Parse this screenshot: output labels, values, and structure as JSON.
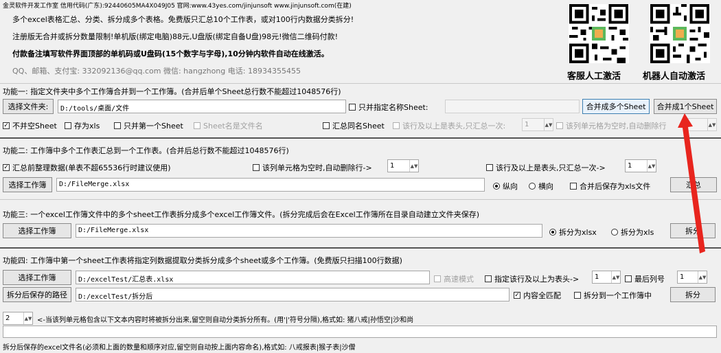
{
  "header": {
    "company_line": "金灵软件开发工作室 信用代码(广东):92440605MA4X049J05 官网:www.43yes.com/jinjunsoft  www.jinjunsoft.com(在建)",
    "line1": "多个excel表格汇总、分类、拆分成多个表格。免费版只汇总10个工作表，或对100行内数据分类拆分!",
    "line2": "注册版无合并或拆分数量限制!单机版(绑定电脑)88元,U盘版(绑定自备U盘)98元!微信二维码付款!",
    "line3": "付款备注填写软件界面顶部的单机码或U盘码(15个数字与字母),10分钟内软件自动在线激活。",
    "contact": "QQ、邮箱、支付宝: 332092136@qq.com   微信: hangzhong   电话: 18934355455",
    "qr1_caption": "客服人工激活",
    "qr2_caption": "机器人自动激活"
  },
  "f1": {
    "title": "功能一: 指定文件夹中多个工作簿合并到一个工作簿。(合并后单个Sheet总行数不能超过1048576行)",
    "select_folder": "选择文件夹:",
    "folder_path": "D:/tools/桌面/文件",
    "only_named_sheet": "只并指定名称Sheet:",
    "merge_multi": "合并成多个Sheet",
    "merge_one": "合并成1个Sheet",
    "no_empty_sheet": "不并空Sheet",
    "save_xls": "存为xls",
    "only_first_sheet": "只并第一个Sheet",
    "sheet_name_is_file": "Sheet名是文件名",
    "sum_same_sheet": "汇总同名Sheet",
    "header_rows": "该行及以上是表头,只汇总一次:",
    "header_rows_val": "1",
    "empty_col_del": "该列单元格为空时,自动删除行",
    "empty_col_val": "1"
  },
  "f2": {
    "title": "功能二: 工作簿中多个工作表汇总到一个工作表。(合并后总行数不能超过1048576行)",
    "tidy_before": "汇总前整理数据(单表不超65536行时建议使用)",
    "empty_col_del": "该列单元格为空时,自动删除行->",
    "empty_col_val": "1",
    "header_rows": "该行及以上是表头,只汇总一次->",
    "header_rows_val": "1",
    "select_wb": "选择工作簿",
    "wb_path": "D:/FileMerge.xlsx",
    "vertical": "纵向",
    "horizontal": "横向",
    "save_xls_after": "合并后保存为xls文件",
    "sum_button": "汇总"
  },
  "f3": {
    "title": "功能三: 一个excel工作簿文件中的多个sheet工作表拆分成多个excel工作簿文件。(拆分完成后会在Excel工作簿所在目录自动建立文件夹保存)",
    "select_wb": "选择工作簿",
    "wb_path": "D:/FileMerge.xlsx",
    "split_xlsx": "拆分为xlsx",
    "split_xls": "拆分为xls",
    "split_button": "拆分"
  },
  "f4": {
    "title": "功能四: 工作簿中第一个sheet工作表将指定列数据提取分类拆分成多个sheet或多个工作簿。(免费版只扫描100行数据)",
    "select_wb": "选择工作簿",
    "wb_path": "D:/excelTest/汇总表.xlsx",
    "fast_mode": "高速模式",
    "header_rows": "指定该行及以上为表头->",
    "header_rows_val": "1",
    "last_col": "最后列号",
    "last_col_val": "1",
    "save_path_btn": "拆分后保存的路径",
    "save_path": "D:/excelTest/拆分后",
    "full_match": "内容全匹配",
    "split_to_one": "拆分到一个工作簿中",
    "split_button": "拆分",
    "col_val": "2",
    "col_hint": "<-当该列单元格包含以下文本内容时将被拆分出来,留空则自动分类拆分所有。(用'|'符号分隔),格式如: 猪八戒|孙悟空|沙和尚",
    "name_hint": "拆分后保存的excel文件名(必须和上面的数量和顺序对应,留空则自动按上面内容命名),格式如: 八戒报表|猴子表|沙僧"
  },
  "colors": {
    "arrow": "#e8251e",
    "background": "#f0f0f0",
    "highlight_border": "#3c7fb1"
  }
}
